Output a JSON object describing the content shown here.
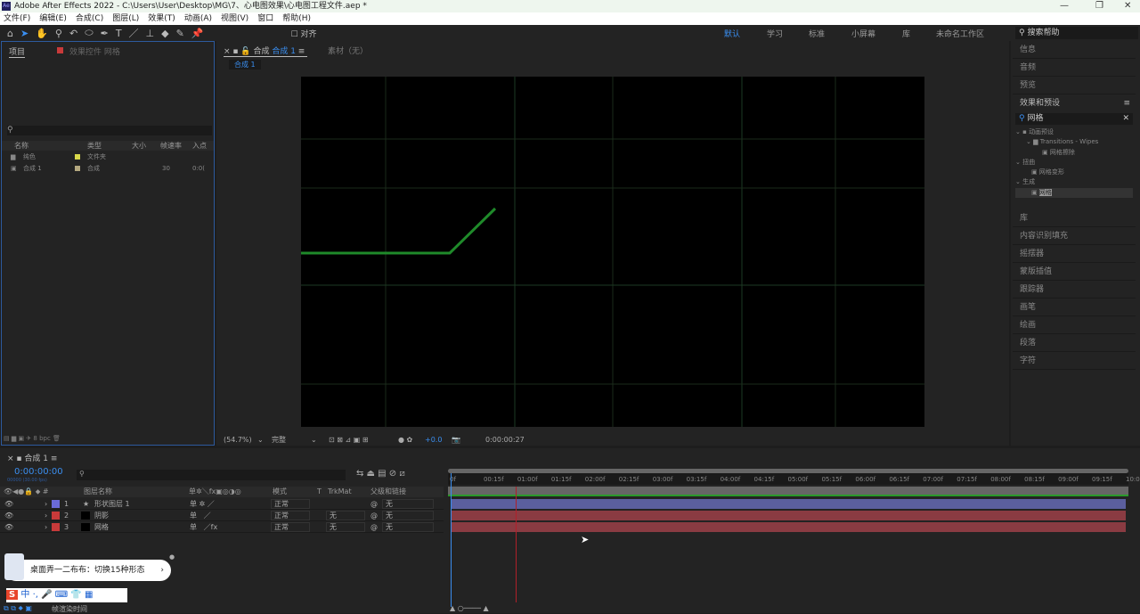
{
  "window": {
    "title": "Adobe After Effects 2022 - C:\\Users\\User\\Desktop\\MG\\7、心电图效果\\心电图工程文件.aep *",
    "logo": "Ae"
  },
  "menu": [
    "文件(F)",
    "编辑(E)",
    "合成(C)",
    "图层(L)",
    "效果(T)",
    "动画(A)",
    "视图(V)",
    "窗口",
    "帮助(H)"
  ],
  "toolbar": {
    "snap_label": "对齐"
  },
  "workspaces": [
    "默认",
    "学习",
    "标准",
    "小屏幕",
    "库",
    "未命名工作区"
  ],
  "help_search": "搜索帮助",
  "project": {
    "tab": "项目",
    "effect_controls_tab": "效果控件 网格",
    "columns": [
      "名称",
      "类型",
      "大小",
      "帧速率",
      "入点"
    ],
    "items": [
      {
        "name": "纯色",
        "type": "文件夹",
        "size": "",
        "fps": "",
        "in": ""
      },
      {
        "name": "合成 1",
        "type": "合成",
        "size": "",
        "fps": "30",
        "in": "0:0("
      }
    ],
    "bpc": "8 bpc"
  },
  "viewer": {
    "tab_prefix": "合成",
    "tab_name": "合成 1",
    "footage_tab": "素材（无）",
    "breadcrumb": "合成 1",
    "zoom": "(54.7%)",
    "quality": "完整",
    "exposure": "+0.0",
    "timecode": "0:00:00:27"
  },
  "right_panels": [
    "信息",
    "音频",
    "预览",
    "效果和预设"
  ],
  "effects_search": "网格",
  "effects_tree": [
    {
      "label": "动画预设",
      "depth": 0
    },
    {
      "label": "Transitions - Wipes",
      "depth": 1
    },
    {
      "label": "网格擦除",
      "depth": 2
    },
    {
      "label": "扭曲",
      "depth": 0
    },
    {
      "label": "网格变形",
      "depth": 1
    },
    {
      "label": "生成",
      "depth": 0
    },
    {
      "label": "网格",
      "depth": 1
    }
  ],
  "right_panels_lower": [
    "库",
    "内容识别填充",
    "摇摆器",
    "蒙版插值",
    "跟踪器",
    "画笔",
    "绘画",
    "段落",
    "字符"
  ],
  "timeline": {
    "tab": "合成 1",
    "timecode": "0:00:00:00",
    "frame_info": "00000 (30.00 fps)",
    "columns": {
      "name": "图层名称",
      "mode": "模式",
      "trkmat": "TrkMat",
      "parent": "父级和链接"
    },
    "ticks": [
      "0f",
      "00:15f",
      "01:00f",
      "01:15f",
      "02:00f",
      "02:15f",
      "03:00f",
      "03:15f",
      "04:00f",
      "04:15f",
      "05:00f",
      "05:15f",
      "06:00f",
      "06:15f",
      "07:00f",
      "07:15f",
      "08:00f",
      "08:15f",
      "09:00f",
      "09:15f",
      "10:0"
    ],
    "layers": [
      {
        "num": "1",
        "name": "形状图层 1",
        "mode": "正常",
        "trkmat": "",
        "parent": "无",
        "color": "#6a6ad8",
        "bar": "#5b5f9e"
      },
      {
        "num": "2",
        "name": "阴影",
        "mode": "正常",
        "trkmat": "无",
        "parent": "无",
        "color": "#c83a3a",
        "bar": "#8a3b42"
      },
      {
        "num": "3",
        "name": "网格",
        "mode": "正常",
        "trkmat": "无",
        "parent": "无",
        "color": "#c83a3a",
        "bar": "#8a3b42"
      }
    ],
    "bottom_label": "帧渲染时间"
  },
  "notification": {
    "text": "桌面弄一二布布：切换15种形态"
  },
  "ime": {
    "label": "中"
  }
}
